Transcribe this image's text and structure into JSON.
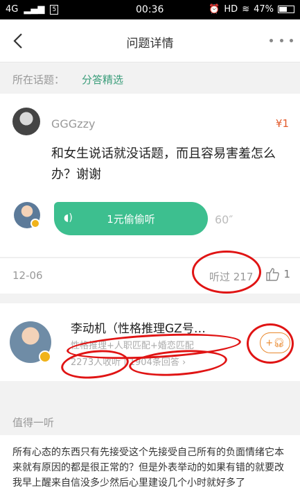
{
  "status": {
    "network": "4G",
    "sim": "5",
    "time": "00:36",
    "hd": "HD",
    "battery": "47%"
  },
  "nav": {
    "title": "问题详情"
  },
  "topic": {
    "label": "所在话题：",
    "value": "分答精选"
  },
  "question": {
    "asker": "GGGzzy",
    "price": "¥1",
    "text": "和女生说话就没话题，而且容易害羞怎么办？谢谢",
    "listen_label": "1元偷偷听",
    "duration": "60″",
    "date": "12-06",
    "listened": "听过 217",
    "likes": "1"
  },
  "answerer": {
    "name": "李动机（性格推理GZ号…",
    "tags": "性格推理+人职匹配+婚恋匹配",
    "followers": "2273人收听",
    "answers": "1904条回答",
    "follow_label": "+"
  },
  "section": {
    "title": "值得一听"
  },
  "excerpt": {
    "text": "所有心态的东西只有先接受这个先接受自己所有的负面情绪它本来就有原因的都是很正常的？但是外表举动的如果有错的就要改我早上醒来自信没多少然后心里建设几个小时就好多了"
  },
  "colors": {
    "accent": "#3dbf8f",
    "link": "#3a9d7a",
    "price": "#e25a2b",
    "follow": "#e9882d",
    "annotation": "#e01414"
  }
}
